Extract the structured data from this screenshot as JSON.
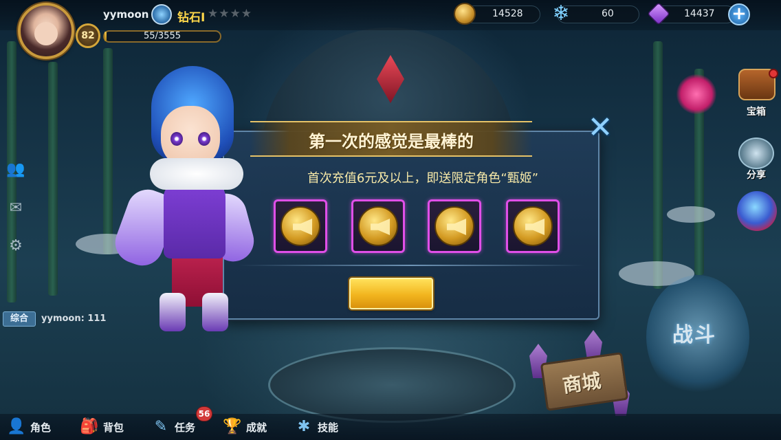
{
  "player": {
    "name": "yymoon",
    "level": "82",
    "rank": "钻石I",
    "stars": "★★★★",
    "exp_text": "55/3555",
    "exp_fraction": 0.0155
  },
  "resources": {
    "gold": "14528",
    "stamina": "60",
    "gems": "14437"
  },
  "side_icons": [
    "friends-icon",
    "mail-icon",
    "settings-icon"
  ],
  "right_menu": {
    "treasure_label": "宝箱",
    "share_label": "分享"
  },
  "chat": {
    "channel": "综合",
    "message": "yymoon:  111"
  },
  "scene": {
    "battle_label": "战斗",
    "shop_label": "商城"
  },
  "dialog": {
    "title": "第一次的感觉是最棒的",
    "subtitle": "首次充值6元及以上，即送限定角色“甄姬”",
    "rewards": [
      "horn-icon",
      "horn-icon",
      "horn-icon",
      "horn-icon"
    ],
    "confirm_label": ""
  },
  "bottom_nav": {
    "role": "角色",
    "bag": "背包",
    "task": "任务",
    "task_badge": "56",
    "achievement": "成就",
    "skill": "技能"
  },
  "colors": {
    "accent_gold": "#f2b51e",
    "reward_border": "#e04fe8",
    "subtitle_text": "#f7e9a8"
  }
}
